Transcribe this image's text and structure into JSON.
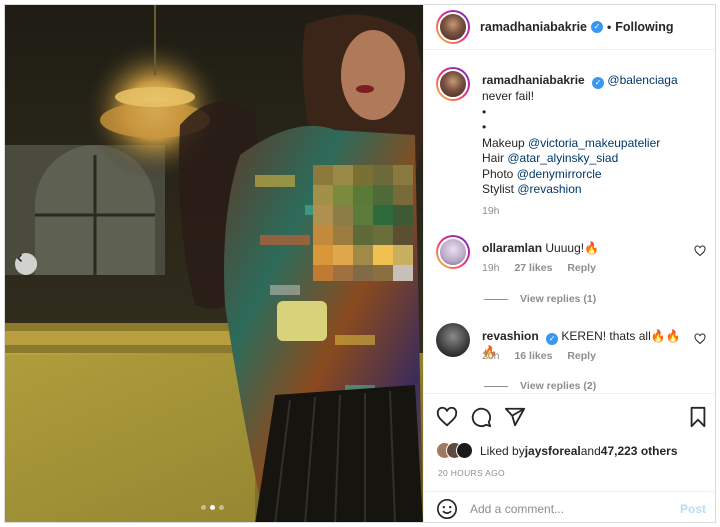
{
  "header": {
    "username": "ramadhaniabakrie",
    "separator": "•",
    "following_label": "Following"
  },
  "caption": {
    "username": "ramadhaniabakrie",
    "mention": "@balenciaga",
    "line1": "never fail!",
    "bullet1": "•",
    "bullet2": "•",
    "makeup_label": "Makeup ",
    "makeup_handle": "@victoria_makeupatelier",
    "hair_label": "Hair ",
    "hair_handle": "@atar_alyinsky_siad",
    "photo_label": "Photo ",
    "photo_handle": "@denymirrorcle",
    "stylist_label": "Stylist ",
    "stylist_handle": "@revashion",
    "time": "19h"
  },
  "comments": [
    {
      "username": "ollaramlan",
      "text": "Uuuug!🔥",
      "time": "19h",
      "likes": "27 likes",
      "reply": "Reply",
      "view_replies": "View replies (1)"
    },
    {
      "username": "revashion",
      "text": "KEREN! thats all🔥🔥🔥",
      "time": "20h",
      "likes": "16 likes",
      "reply": "Reply",
      "view_replies": "View replies (2)"
    }
  ],
  "likes": {
    "prefix": "Liked by ",
    "user": "jaysforeal",
    "middle": " and ",
    "count": "47,223 others"
  },
  "timestamp": "20 HOURS AGO",
  "add_comment": {
    "placeholder": "Add a comment...",
    "post_label": "Post"
  },
  "carousel": {
    "dots": 3,
    "active_index": 1
  },
  "colors": {
    "link": "#00376b",
    "verified": "#3897f0",
    "muted": "#8e8e8e",
    "post_disabled": "#b2dffc"
  }
}
